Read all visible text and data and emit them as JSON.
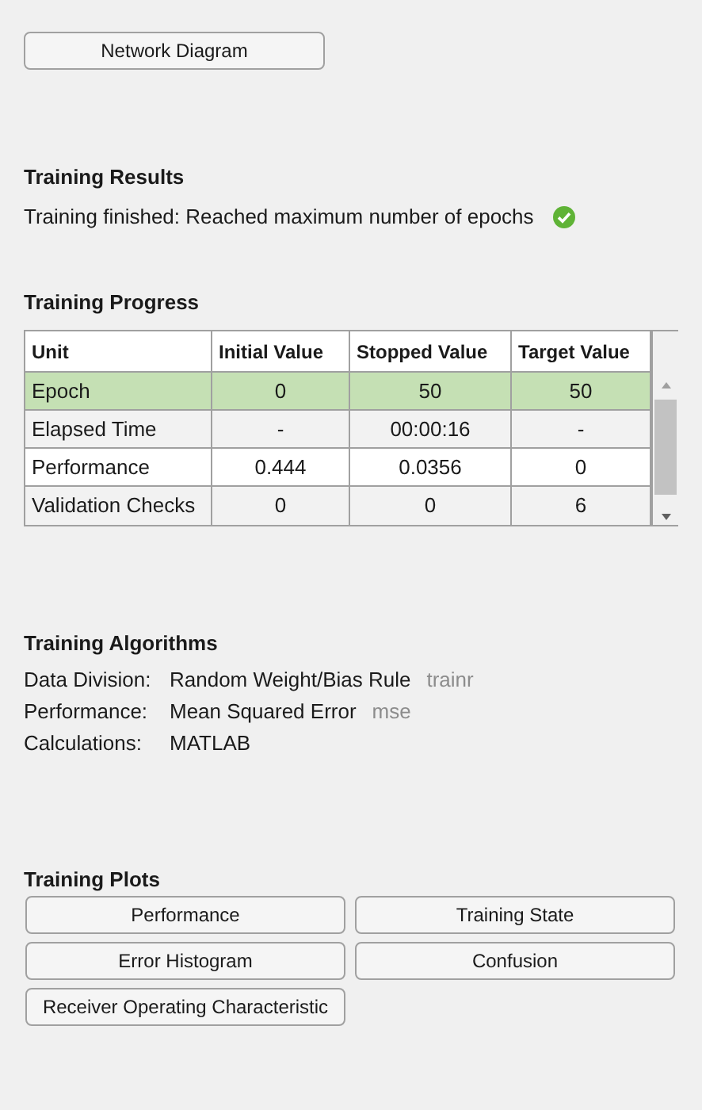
{
  "top_button": {
    "label": "Network Diagram"
  },
  "training_results": {
    "title": "Training Results",
    "status": "Training finished: Reached maximum number of epochs",
    "finished": true
  },
  "training_progress": {
    "title": "Training Progress",
    "columns": [
      "Unit",
      "Initial Value",
      "Stopped Value",
      "Target Value"
    ],
    "rows": [
      {
        "cells": [
          "Epoch",
          "0",
          "50",
          "50"
        ],
        "selected": true
      },
      {
        "cells": [
          "Elapsed Time",
          "-",
          "00:00:16",
          "-"
        ],
        "selected": false
      },
      {
        "cells": [
          "Performance",
          "0.444",
          "0.0356",
          "0"
        ],
        "selected": false
      },
      {
        "cells": [
          "Validation Checks",
          "0",
          "0",
          "6"
        ],
        "selected": false
      }
    ]
  },
  "training_algorithms": {
    "title": "Training Algorithms",
    "items": [
      {
        "label": "Data Division:",
        "value": "Random Weight/Bias Rule",
        "function": "trainr"
      },
      {
        "label": "Performance:",
        "value": "Mean Squared Error",
        "function": "mse"
      },
      {
        "label": "Calculations:",
        "value": "MATLAB"
      }
    ]
  },
  "training_plots": {
    "title": "Training Plots",
    "buttons": [
      "Performance",
      "Training State",
      "Error Histogram",
      "Confusion",
      "Receiver Operating Characteristic"
    ]
  }
}
